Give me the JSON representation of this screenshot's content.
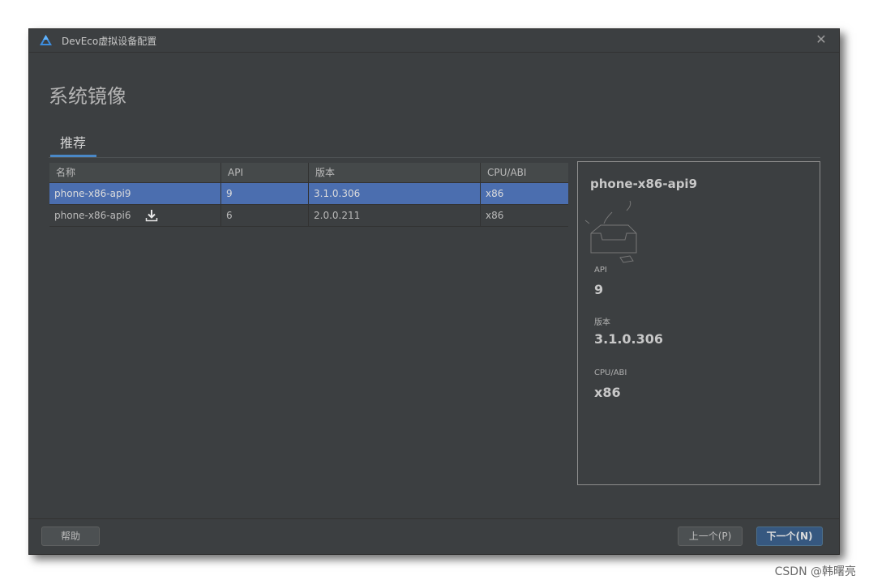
{
  "window": {
    "title": "DevEco虚拟设备配置"
  },
  "page": {
    "title": "系统镜像",
    "tab_label": "推荐"
  },
  "table": {
    "headers": [
      "名称",
      "API",
      "版本",
      "CPU/ABI"
    ],
    "rows": [
      {
        "name": "phone-x86-api9",
        "api": "9",
        "version": "3.1.0.306",
        "cpu": "x86",
        "selected": true,
        "download": false
      },
      {
        "name": "phone-x86-api6",
        "api": "6",
        "version": "2.0.0.211",
        "cpu": "x86",
        "selected": false,
        "download": true
      }
    ]
  },
  "details": {
    "name": "phone-x86-api9",
    "api_label": "API",
    "api_value": "9",
    "version_label": "版本",
    "version_value": "3.1.0.306",
    "cpu_label": "CPU/ABI",
    "cpu_value": "x86"
  },
  "footer": {
    "help_label": "帮助",
    "prev_label": "上一个(P)",
    "next_label": "下一个(N)"
  },
  "watermark": "CSDN @韩曙亮",
  "colors": {
    "selection": "#4b6eaf",
    "accent": "#4a88c7",
    "dialog_bg": "#3c3f41",
    "primary_button": "#365880"
  }
}
